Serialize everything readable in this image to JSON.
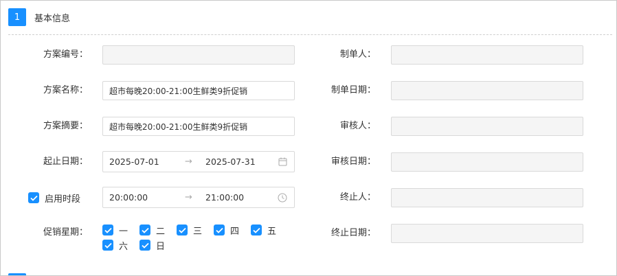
{
  "section": {
    "number": "1",
    "title": "基本信息"
  },
  "left": {
    "plan_no": {
      "label": "方案编号：",
      "value": ""
    },
    "plan_name": {
      "label": "方案名称：",
      "value": "超市每晚20:00-21:00生鲜类9折促销"
    },
    "plan_summary": {
      "label": "方案摘要：",
      "value": "超市每晚20:00-21:00生鲜类9折促销"
    },
    "date_range": {
      "label": "起止日期：",
      "start": "2025-07-01",
      "arrow": "→",
      "end": "2025-07-31",
      "icon": "calendar-icon"
    },
    "time_range": {
      "label": "启用时段",
      "checked": true,
      "start": "20:00:00",
      "arrow": "→",
      "end": "21:00:00",
      "icon": "clock-icon"
    },
    "weekdays": {
      "label": "促销星期：",
      "days": [
        {
          "text": "一",
          "checked": true
        },
        {
          "text": "二",
          "checked": true
        },
        {
          "text": "三",
          "checked": true
        },
        {
          "text": "四",
          "checked": true
        },
        {
          "text": "五",
          "checked": true
        },
        {
          "text": "六",
          "checked": true
        },
        {
          "text": "日",
          "checked": true
        }
      ]
    }
  },
  "right": {
    "creator": {
      "label": "制单人：",
      "value": ""
    },
    "create_date": {
      "label": "制单日期：",
      "value": ""
    },
    "auditor": {
      "label": "审核人：",
      "value": ""
    },
    "audit_date": {
      "label": "审核日期：",
      "value": ""
    },
    "terminator": {
      "label": "终止人：",
      "value": ""
    },
    "terminate_date": {
      "label": "终止日期：",
      "value": ""
    }
  },
  "colors": {
    "accent": "#1890ff",
    "disabled_bg": "#f5f5f5",
    "border": "#d9d9d9"
  }
}
